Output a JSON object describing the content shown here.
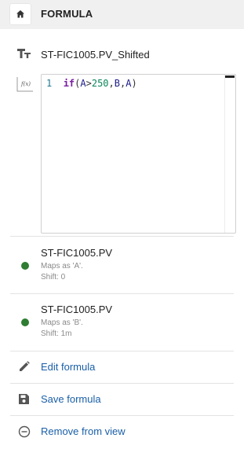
{
  "header": {
    "title": "FORMULA",
    "home_icon": "home-icon"
  },
  "formula_name": {
    "icon": "text-type-icon",
    "value": "ST-FIC1005.PV_Shifted"
  },
  "editor": {
    "icon": "function-icon",
    "icon_text": "f(x)",
    "line_number": "1",
    "code": {
      "keyword": "if",
      "open": "(",
      "a1": "A",
      "op": ">",
      "num": "250",
      "c1": ",",
      "b": "B",
      "c2": ",",
      "a2": "A",
      "close": ")"
    }
  },
  "sources": [
    {
      "name": "ST-FIC1005.PV",
      "maps": "Maps as 'A'.",
      "shift": "Shift: 0",
      "color": "#2e7d32"
    },
    {
      "name": "ST-FIC1005.PV",
      "maps": "Maps as 'B'.",
      "shift": "Shift: 1m",
      "color": "#2e7d32"
    }
  ],
  "actions": [
    {
      "label": "Edit formula",
      "icon": "pencil-icon"
    },
    {
      "label": "Save formula",
      "icon": "save-icon"
    },
    {
      "label": "Remove from view",
      "icon": "minus-circle-icon"
    }
  ],
  "colors": {
    "link": "#1a5fa8",
    "status_ok": "#2e7d32",
    "header_bg": "#f0f0f0"
  }
}
